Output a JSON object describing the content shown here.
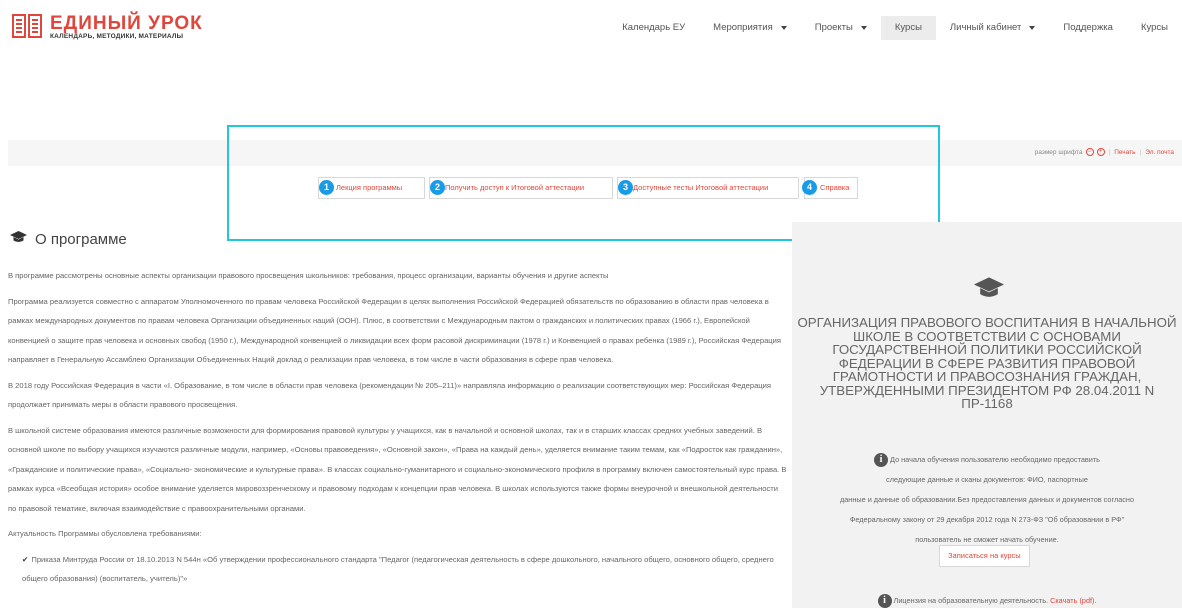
{
  "header": {
    "logo_title": "ЕДИНЫЙ УРОК",
    "logo_subtitle": "КАЛЕНДАРЬ, МЕТОДИКИ, МАТЕРИАЛЫ",
    "nav": [
      {
        "label": "Календарь ЕУ",
        "dropdown": false
      },
      {
        "label": "Мероприятия",
        "dropdown": true
      },
      {
        "label": "Проекты",
        "dropdown": true
      },
      {
        "label": "Курсы",
        "dropdown": false,
        "active": true
      },
      {
        "label": "Личный кабинет",
        "dropdown": true
      },
      {
        "label": "Поддержка",
        "dropdown": false
      },
      {
        "label": "Курсы",
        "dropdown": false
      }
    ]
  },
  "toolbar": {
    "font_size_label": "размер шрифта",
    "print_label": "Печать",
    "email_label": "Эл. почта"
  },
  "tabs": [
    {
      "num": "1",
      "label": "Лекция программы"
    },
    {
      "num": "2",
      "label": "Получить доступ к Итоговой аттестации"
    },
    {
      "num": "3",
      "label": "Доступные тесты Итоговой аттестации"
    },
    {
      "num": "4",
      "label": "Справка"
    }
  ],
  "section": {
    "heading": "О программе"
  },
  "main": {
    "p1": "В программе рассмотрены основные аспекты организации правового просвещения школьников: требования, процесс организации, варианты обучения и другие аспекты",
    "p2": "Программа реализуется совместно с аппаратом Уполномоченного по правам человека Российской Федерации в целях выполнения Российской Федерацией обязательств по образованию в области прав человека в рамках международных документов по правам человека Организации объединенных наций (ООН). Плюс, в соответствии с Международным пактом о гражданских и политических правах (1966 г.), Европейской конвенцией о защите прав человека и основных свобод (1950 г.), Международной конвенцией о ликвидации всех форм расовой дискриминации (1978 г.) и Конвенцией о правах ребенка (1989 г.), Российская Федерация направляет в Генеральную Ассамблею Организации Объединенных Наций доклад о реализации прав человека, в том числе в части образования в сфере прав человека.",
    "p3": "В 2018 году Российская Федерация в части «I. Образование, в том числе в области прав человека (рекомендации № 205–211)» направляла информацию о реализации соответствующих мер: Российская Федерация продолжает принимать меры в области правового просвещения.",
    "p4": "В школьной системе образования имеются различные возможности для формирования правовой культуры у учащихся, как в начальной и основной школах, так и в старших классах средних учебных заведений. В основной школе по выбору учащихся изучаются различные модули, например, «Основы правоведения», «Основной закон», «Права на каждый день», уделяется внимание таким темам, как «Подросток как гражданин», «Гражданские и политические права», «Социально- экономические и культурные права». В классах социально-гуманитарного и социально-экономического профиля в программу включен самостоятельный курс права. В рамках курса «Всеобщая история» особое внимание уделяется мировоззренческому и правовому подходам к концепции прав человека. В школах используются также формы внеурочной и внешкольной деятельности по правовой тематике, включая взаимодействие с правоохранительными органами.",
    "p5": "Актуальность Программы обусловлена требованиями:",
    "p6": "Приказа Минтруда России от 18.10.2013 N 544н «Об утверждении профессионального стандарта \"Педагог (педагогическая деятельность в сфере дошкольного, начального общего, основного общего, среднего общего образования) (воспитатель, учитель)\"»"
  },
  "sidebar": {
    "title": "ОРГАНИЗАЦИЯ ПРАВОВОГО ВОСПИТАНИЯ В НАЧАЛЬНОЙ ШКОЛЕ В СООТВЕТСТВИИ С ОСНОВАМИ ГОСУДАРСТВЕННОЙ ПОЛИТИКИ РОССИЙСКОЙ ФЕДЕРАЦИИ В СФЕРЕ РАЗВИТИЯ ПРАВОВОЙ ГРАМОТНОСТИ И ПРАВОСОЗНАНИЯ ГРАЖДАН, УТВЕРЖДЕННЫМИ ПРЕЗИДЕНТОМ РФ 28.04.2011 N ПР-1168",
    "note_line1": "До начала обучения пользователю необходимо предоставить",
    "note_line2": "следующие данные и сканы документов: ФИО, паспортные",
    "note_line3": "данные и данные об образовании.Без предоставления данных и документов согласно",
    "note_line4": "Федеральному закону от 29 декабря 2012 года N 273-ФЗ \"Об образовании в РФ\"",
    "note_line5": "пользователь не сможет начать обучение.",
    "enroll_label": "Записаться на курсы",
    "license_text": "Лицензия на образовательную деятельность.",
    "license_link": "Скачать (pdf)."
  },
  "colors": {
    "accent": "#e0463b",
    "badge": "#1a9be6",
    "highlight": "#22c6dd"
  }
}
